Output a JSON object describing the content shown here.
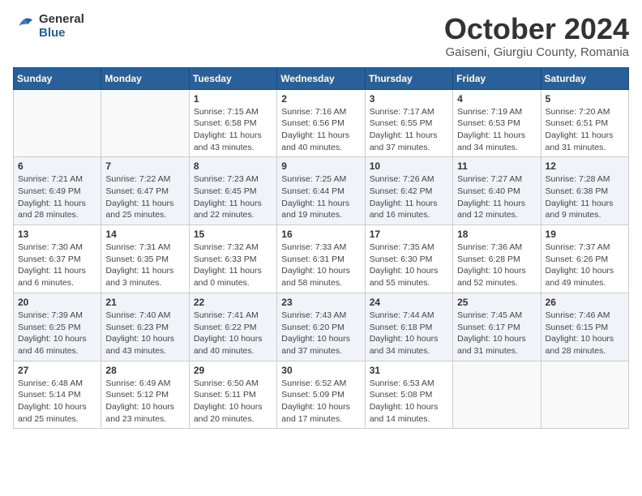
{
  "header": {
    "logo_general": "General",
    "logo_blue": "Blue",
    "month_title": "October 2024",
    "subtitle": "Gaiseni, Giurgiu County, Romania"
  },
  "weekdays": [
    "Sunday",
    "Monday",
    "Tuesday",
    "Wednesday",
    "Thursday",
    "Friday",
    "Saturday"
  ],
  "weeks": [
    [
      {
        "day": "",
        "info": ""
      },
      {
        "day": "",
        "info": ""
      },
      {
        "day": "1",
        "info": "Sunrise: 7:15 AM\nSunset: 6:58 PM\nDaylight: 11 hours and 43 minutes."
      },
      {
        "day": "2",
        "info": "Sunrise: 7:16 AM\nSunset: 6:56 PM\nDaylight: 11 hours and 40 minutes."
      },
      {
        "day": "3",
        "info": "Sunrise: 7:17 AM\nSunset: 6:55 PM\nDaylight: 11 hours and 37 minutes."
      },
      {
        "day": "4",
        "info": "Sunrise: 7:19 AM\nSunset: 6:53 PM\nDaylight: 11 hours and 34 minutes."
      },
      {
        "day": "5",
        "info": "Sunrise: 7:20 AM\nSunset: 6:51 PM\nDaylight: 11 hours and 31 minutes."
      }
    ],
    [
      {
        "day": "6",
        "info": "Sunrise: 7:21 AM\nSunset: 6:49 PM\nDaylight: 11 hours and 28 minutes."
      },
      {
        "day": "7",
        "info": "Sunrise: 7:22 AM\nSunset: 6:47 PM\nDaylight: 11 hours and 25 minutes."
      },
      {
        "day": "8",
        "info": "Sunrise: 7:23 AM\nSunset: 6:45 PM\nDaylight: 11 hours and 22 minutes."
      },
      {
        "day": "9",
        "info": "Sunrise: 7:25 AM\nSunset: 6:44 PM\nDaylight: 11 hours and 19 minutes."
      },
      {
        "day": "10",
        "info": "Sunrise: 7:26 AM\nSunset: 6:42 PM\nDaylight: 11 hours and 16 minutes."
      },
      {
        "day": "11",
        "info": "Sunrise: 7:27 AM\nSunset: 6:40 PM\nDaylight: 11 hours and 12 minutes."
      },
      {
        "day": "12",
        "info": "Sunrise: 7:28 AM\nSunset: 6:38 PM\nDaylight: 11 hours and 9 minutes."
      }
    ],
    [
      {
        "day": "13",
        "info": "Sunrise: 7:30 AM\nSunset: 6:37 PM\nDaylight: 11 hours and 6 minutes."
      },
      {
        "day": "14",
        "info": "Sunrise: 7:31 AM\nSunset: 6:35 PM\nDaylight: 11 hours and 3 minutes."
      },
      {
        "day": "15",
        "info": "Sunrise: 7:32 AM\nSunset: 6:33 PM\nDaylight: 11 hours and 0 minutes."
      },
      {
        "day": "16",
        "info": "Sunrise: 7:33 AM\nSunset: 6:31 PM\nDaylight: 10 hours and 58 minutes."
      },
      {
        "day": "17",
        "info": "Sunrise: 7:35 AM\nSunset: 6:30 PM\nDaylight: 10 hours and 55 minutes."
      },
      {
        "day": "18",
        "info": "Sunrise: 7:36 AM\nSunset: 6:28 PM\nDaylight: 10 hours and 52 minutes."
      },
      {
        "day": "19",
        "info": "Sunrise: 7:37 AM\nSunset: 6:26 PM\nDaylight: 10 hours and 49 minutes."
      }
    ],
    [
      {
        "day": "20",
        "info": "Sunrise: 7:39 AM\nSunset: 6:25 PM\nDaylight: 10 hours and 46 minutes."
      },
      {
        "day": "21",
        "info": "Sunrise: 7:40 AM\nSunset: 6:23 PM\nDaylight: 10 hours and 43 minutes."
      },
      {
        "day": "22",
        "info": "Sunrise: 7:41 AM\nSunset: 6:22 PM\nDaylight: 10 hours and 40 minutes."
      },
      {
        "day": "23",
        "info": "Sunrise: 7:43 AM\nSunset: 6:20 PM\nDaylight: 10 hours and 37 minutes."
      },
      {
        "day": "24",
        "info": "Sunrise: 7:44 AM\nSunset: 6:18 PM\nDaylight: 10 hours and 34 minutes."
      },
      {
        "day": "25",
        "info": "Sunrise: 7:45 AM\nSunset: 6:17 PM\nDaylight: 10 hours and 31 minutes."
      },
      {
        "day": "26",
        "info": "Sunrise: 7:46 AM\nSunset: 6:15 PM\nDaylight: 10 hours and 28 minutes."
      }
    ],
    [
      {
        "day": "27",
        "info": "Sunrise: 6:48 AM\nSunset: 5:14 PM\nDaylight: 10 hours and 25 minutes."
      },
      {
        "day": "28",
        "info": "Sunrise: 6:49 AM\nSunset: 5:12 PM\nDaylight: 10 hours and 23 minutes."
      },
      {
        "day": "29",
        "info": "Sunrise: 6:50 AM\nSunset: 5:11 PM\nDaylight: 10 hours and 20 minutes."
      },
      {
        "day": "30",
        "info": "Sunrise: 6:52 AM\nSunset: 5:09 PM\nDaylight: 10 hours and 17 minutes."
      },
      {
        "day": "31",
        "info": "Sunrise: 6:53 AM\nSunset: 5:08 PM\nDaylight: 10 hours and 14 minutes."
      },
      {
        "day": "",
        "info": ""
      },
      {
        "day": "",
        "info": ""
      }
    ]
  ]
}
